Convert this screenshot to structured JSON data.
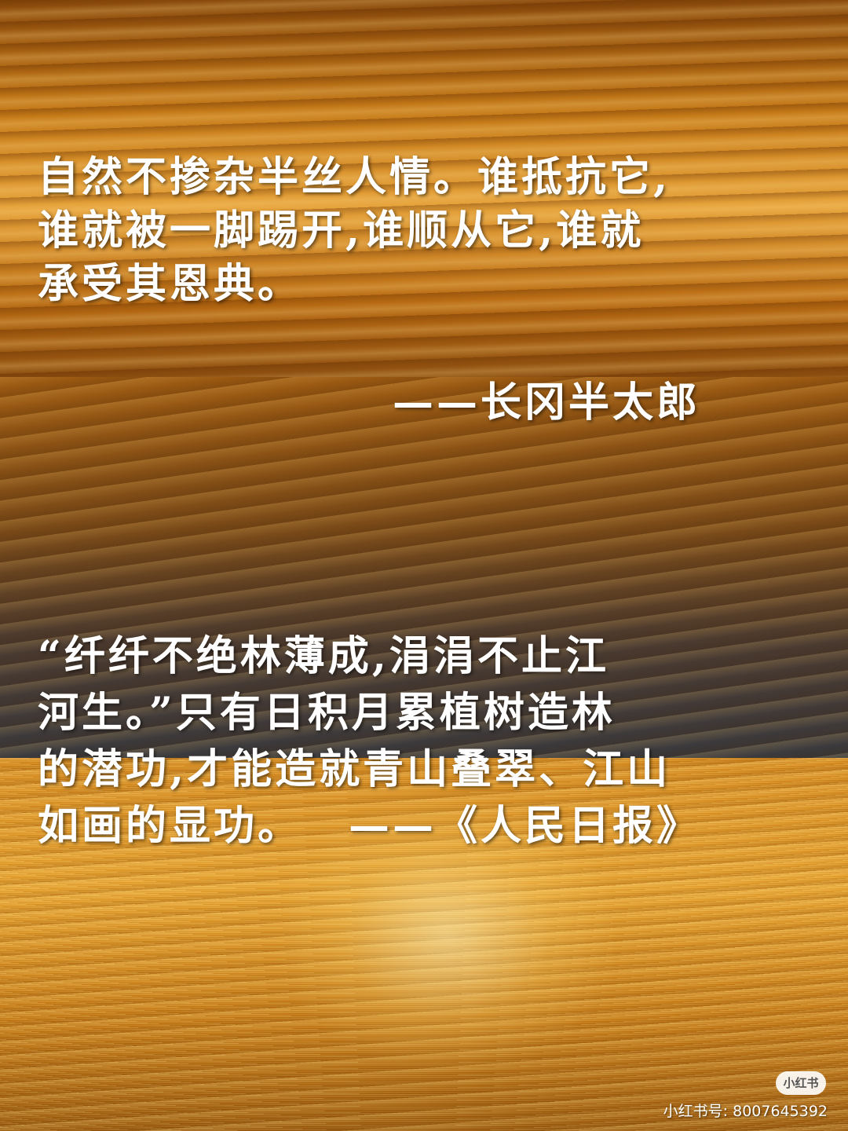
{
  "quote1": {
    "lines": [
      "自然不掺杂半丝人情。谁抵抗它,",
      "谁就被一脚踢开,谁顺从它,谁就",
      "承受其恩典。"
    ],
    "attribution": "——长冈半太郎"
  },
  "quote2": {
    "lines": [
      "“纤纤不绝林薄成,涓涓不止江",
      "河生。”只有日积月累植树造林",
      "的潜功,才能造就青山叠翠、江山",
      "如画的显功。"
    ],
    "attribution": "——《人民日报》"
  },
  "watermark": {
    "logo": "小红书",
    "account": "小红书号: 8007645392"
  }
}
